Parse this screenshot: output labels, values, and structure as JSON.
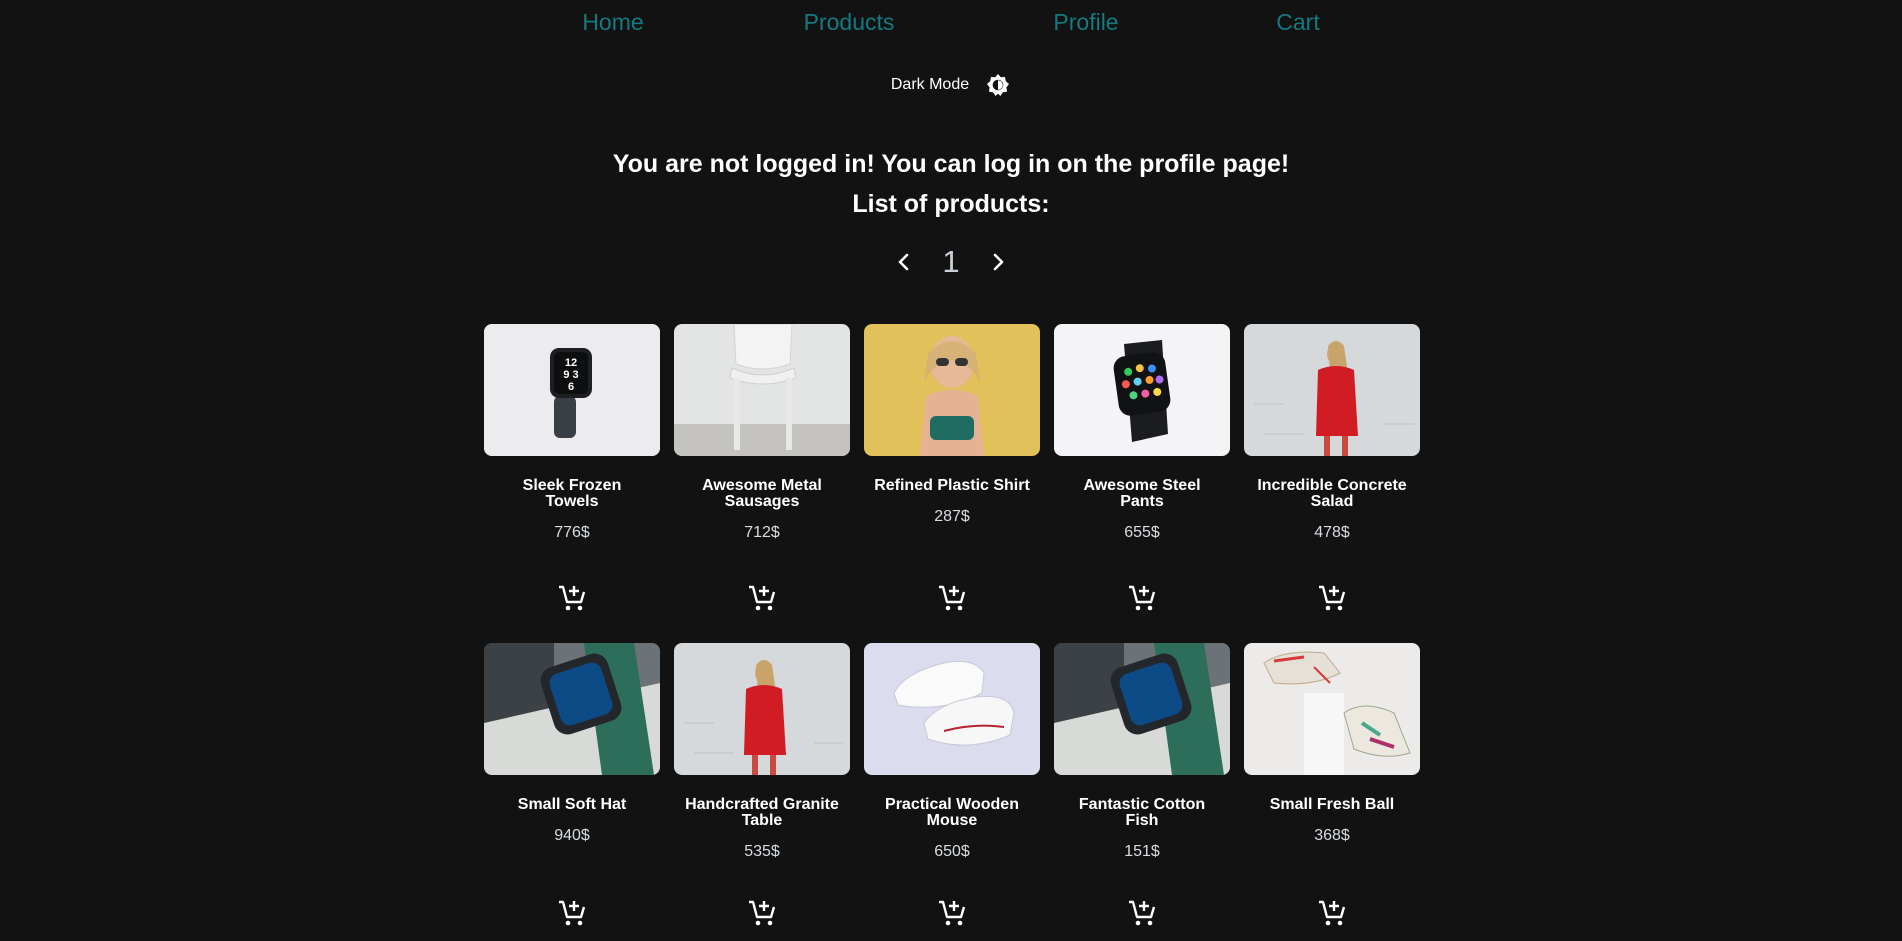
{
  "nav": {
    "home": "Home",
    "products": "Products",
    "profile": "Profile",
    "cart": "Cart"
  },
  "theme": {
    "label": "Dark Mode",
    "icon": "brightness-toggle-icon",
    "accent": "#157a80",
    "background": "#121212"
  },
  "main": {
    "notice": "You are not logged in! You can log in on the profile page!",
    "list_heading": "List of products:"
  },
  "pagination": {
    "page": "1",
    "prev_icon": "chevron-left-icon",
    "next_icon": "chevron-right-icon"
  },
  "products": [
    {
      "name": "Sleek Frozen Towels",
      "price": "776$",
      "image": "smartwatch-black-band"
    },
    {
      "name": "Awesome Metal Sausages",
      "price": "712$",
      "image": "white-chair"
    },
    {
      "name": "Refined Plastic Shirt",
      "price": "287$",
      "image": "woman-sunglasses-yellow-wall"
    },
    {
      "name": "Awesome Steel Pants",
      "price": "655$",
      "image": "smartwatch-apps"
    },
    {
      "name": "Incredible Concrete Salad",
      "price": "478$",
      "image": "woman-red-dress"
    },
    {
      "name": "Small Soft Hat",
      "price": "940$",
      "image": "smartwatch-green-band"
    },
    {
      "name": "Handcrafted Granite Table",
      "price": "535$",
      "image": "woman-red-dress"
    },
    {
      "name": "Practical Wooden Mouse",
      "price": "650$",
      "image": "white-sneakers"
    },
    {
      "name": "Fantastic Cotton Fish",
      "price": "151$",
      "image": "smartwatch-green-band"
    },
    {
      "name": "Small Fresh Ball",
      "price": "368$",
      "image": "colorful-sneakers"
    }
  ],
  "cart_icon": "add-to-cart-icon"
}
